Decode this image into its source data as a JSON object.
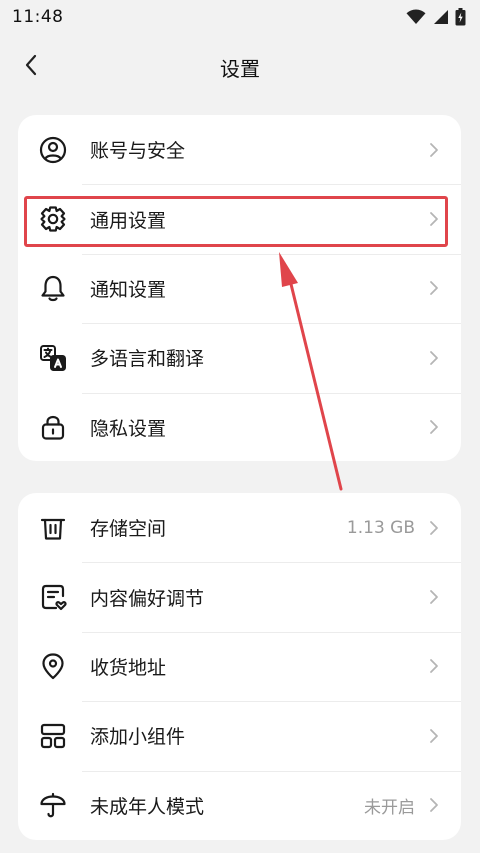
{
  "status_bar": {
    "time": "11:48",
    "icons": [
      "wifi-icon",
      "signal-icon",
      "battery-icon"
    ]
  },
  "header": {
    "back_icon": "chevron-left-icon",
    "title": "设置"
  },
  "section_1": {
    "items": [
      {
        "label": "账号与安全",
        "icon": "user-circle-icon"
      },
      {
        "label": "通用设置",
        "icon": "gear-icon"
      },
      {
        "label": "通知设置",
        "icon": "bell-icon"
      },
      {
        "label": "多语言和翻译",
        "icon": "translate-icon"
      },
      {
        "label": "隐私设置",
        "icon": "lock-icon"
      }
    ]
  },
  "section_2": {
    "items": [
      {
        "label": "存储空间",
        "icon": "trash-icon",
        "value": "1.13 GB"
      },
      {
        "label": "内容偏好调节",
        "icon": "content-heart-icon"
      },
      {
        "label": "收货地址",
        "icon": "location-pin-icon"
      },
      {
        "label": "添加小组件",
        "icon": "widgets-icon"
      },
      {
        "label": "未成年人模式",
        "icon": "umbrella-icon",
        "value": "未开启"
      }
    ]
  },
  "annotation": {
    "highlight_color": "#e0454b",
    "highlighted_item": "通用设置"
  },
  "colors": {
    "background": "#f2f2f2",
    "card": "#ffffff",
    "secondary_text": "#9a9a9a",
    "chevron": "#b5b5b5"
  }
}
